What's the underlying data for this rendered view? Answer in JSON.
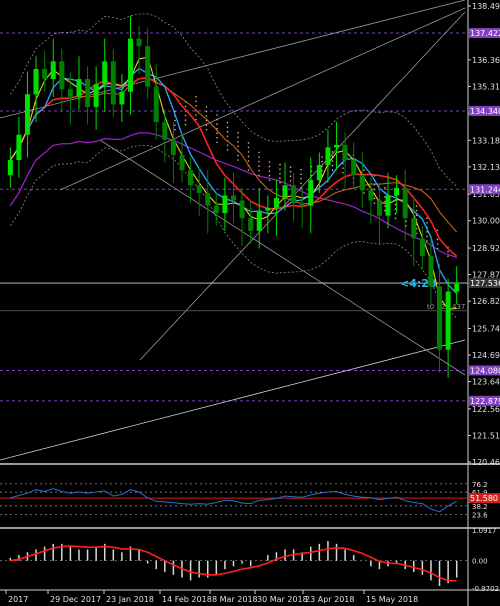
{
  "chart_data": {
    "type": "candlestick",
    "main": {
      "y_ticks": [
        "138.490",
        "136.360",
        "135.310",
        "134.260",
        "133.180",
        "132.130",
        "131.050",
        "130.000",
        "128.920",
        "127.870",
        "126.820",
        "125.740",
        "124.690",
        "123.640",
        "122.560",
        "121.510",
        "120.460"
      ],
      "ylim": [
        120.46,
        138.49
      ],
      "x_labels": [
        "2017",
        "29 Dec 2017",
        "23 Jan 2018",
        "14 Feb 2018",
        "8 Mar 2018",
        "30 Mar 2018",
        "23 Apr 2018",
        "15 May 2018"
      ],
      "level_lines": [
        {
          "value": 137.422,
          "label": "137.422"
        },
        {
          "value": 134.34,
          "label": "134.340"
        },
        {
          "value": 131.244,
          "label": "131.244"
        },
        {
          "value": 124.08,
          "label": "124.080"
        },
        {
          "value": 122.879,
          "label": "122.879"
        }
      ],
      "current_price": {
        "value": 127.536,
        "label": "127.536"
      },
      "timer": "<4:28",
      "t0_label": "t0 126.437",
      "t0_value": 126.437,
      "close_series": [
        132.4,
        133.4,
        135.0,
        136.0,
        135.6,
        136.3,
        135.2,
        134.9,
        135.6,
        134.5,
        135.4,
        136.3,
        134.6,
        135.1,
        137.2,
        136.9,
        135.3,
        133.9,
        133.2,
        132.6,
        132.0,
        131.4,
        131.1,
        130.6,
        130.3,
        131.0,
        130.8,
        130.1,
        129.6,
        130.4,
        130.5,
        130.9,
        131.4,
        130.7,
        130.6,
        131.6,
        132.2,
        132.9,
        133.0,
        132.4,
        131.8,
        131.2,
        130.8,
        130.2,
        131.0,
        131.3,
        130.1,
        129.3,
        128.6,
        127.4,
        124.9,
        127.2,
        127.5
      ]
    },
    "rsi": {
      "y_ticks": [
        "76.2",
        "61.9",
        "38.2",
        "23.6"
      ],
      "level_label": "51.580",
      "values": [
        52,
        56,
        60,
        66,
        63,
        68,
        63,
        60,
        62,
        60,
        62,
        64,
        55,
        58,
        66,
        62,
        52,
        46,
        45,
        44,
        42,
        41,
        42,
        41,
        44,
        48,
        47,
        43,
        42,
        48,
        49,
        51,
        55,
        54,
        53,
        57,
        60,
        62,
        63,
        58,
        55,
        53,
        52,
        49,
        51,
        53,
        47,
        44,
        42,
        33,
        28,
        38,
        46
      ]
    },
    "macd": {
      "y_ticks": [
        "1.0917",
        "0.00",
        "-0.9702"
      ],
      "histogram": [
        0.1,
        0.2,
        0.3,
        0.4,
        0.5,
        0.6,
        0.6,
        0.5,
        0.4,
        0.4,
        0.5,
        0.6,
        0.4,
        0.3,
        0.5,
        0.4,
        -0.1,
        -0.3,
        -0.4,
        -0.5,
        -0.6,
        -0.7,
        -0.6,
        -0.6,
        -0.5,
        -0.3,
        -0.2,
        -0.1,
        -0.2,
        0.0,
        0.2,
        0.3,
        0.4,
        0.4,
        0.3,
        0.5,
        0.6,
        0.7,
        0.6,
        0.4,
        0.2,
        0.0,
        -0.2,
        -0.3,
        -0.2,
        -0.1,
        -0.3,
        -0.4,
        -0.5,
        -0.7,
        -0.9,
        -0.8,
        -0.6
      ],
      "signal": [
        0.0,
        0.05,
        0.15,
        0.25,
        0.35,
        0.45,
        0.5,
        0.52,
        0.5,
        0.48,
        0.48,
        0.5,
        0.48,
        0.42,
        0.42,
        0.4,
        0.3,
        0.15,
        0.0,
        -0.15,
        -0.28,
        -0.4,
        -0.46,
        -0.5,
        -0.5,
        -0.45,
        -0.38,
        -0.3,
        -0.25,
        -0.18,
        -0.08,
        0.05,
        0.15,
        0.22,
        0.26,
        0.3,
        0.36,
        0.42,
        0.46,
        0.44,
        0.36,
        0.26,
        0.12,
        -0.02,
        -0.08,
        -0.1,
        -0.16,
        -0.24,
        -0.32,
        -0.44,
        -0.6,
        -0.7,
        -0.72
      ]
    },
    "colors": {
      "up_candle": "#00e000",
      "down_candle": "#008000",
      "ma_red": "#ff2020",
      "ma_yellow": "#e0d020",
      "ma_blue": "#2aa9ff",
      "ma_orange": "#d46a10",
      "ma_purple": "#a020d0",
      "ichimoku": "#e8b080",
      "level_line": "#8040c0",
      "accent_cyan": "#23b8e8",
      "rsi_line": "#2a6fd0",
      "macd_signal": "#ff2020"
    }
  }
}
